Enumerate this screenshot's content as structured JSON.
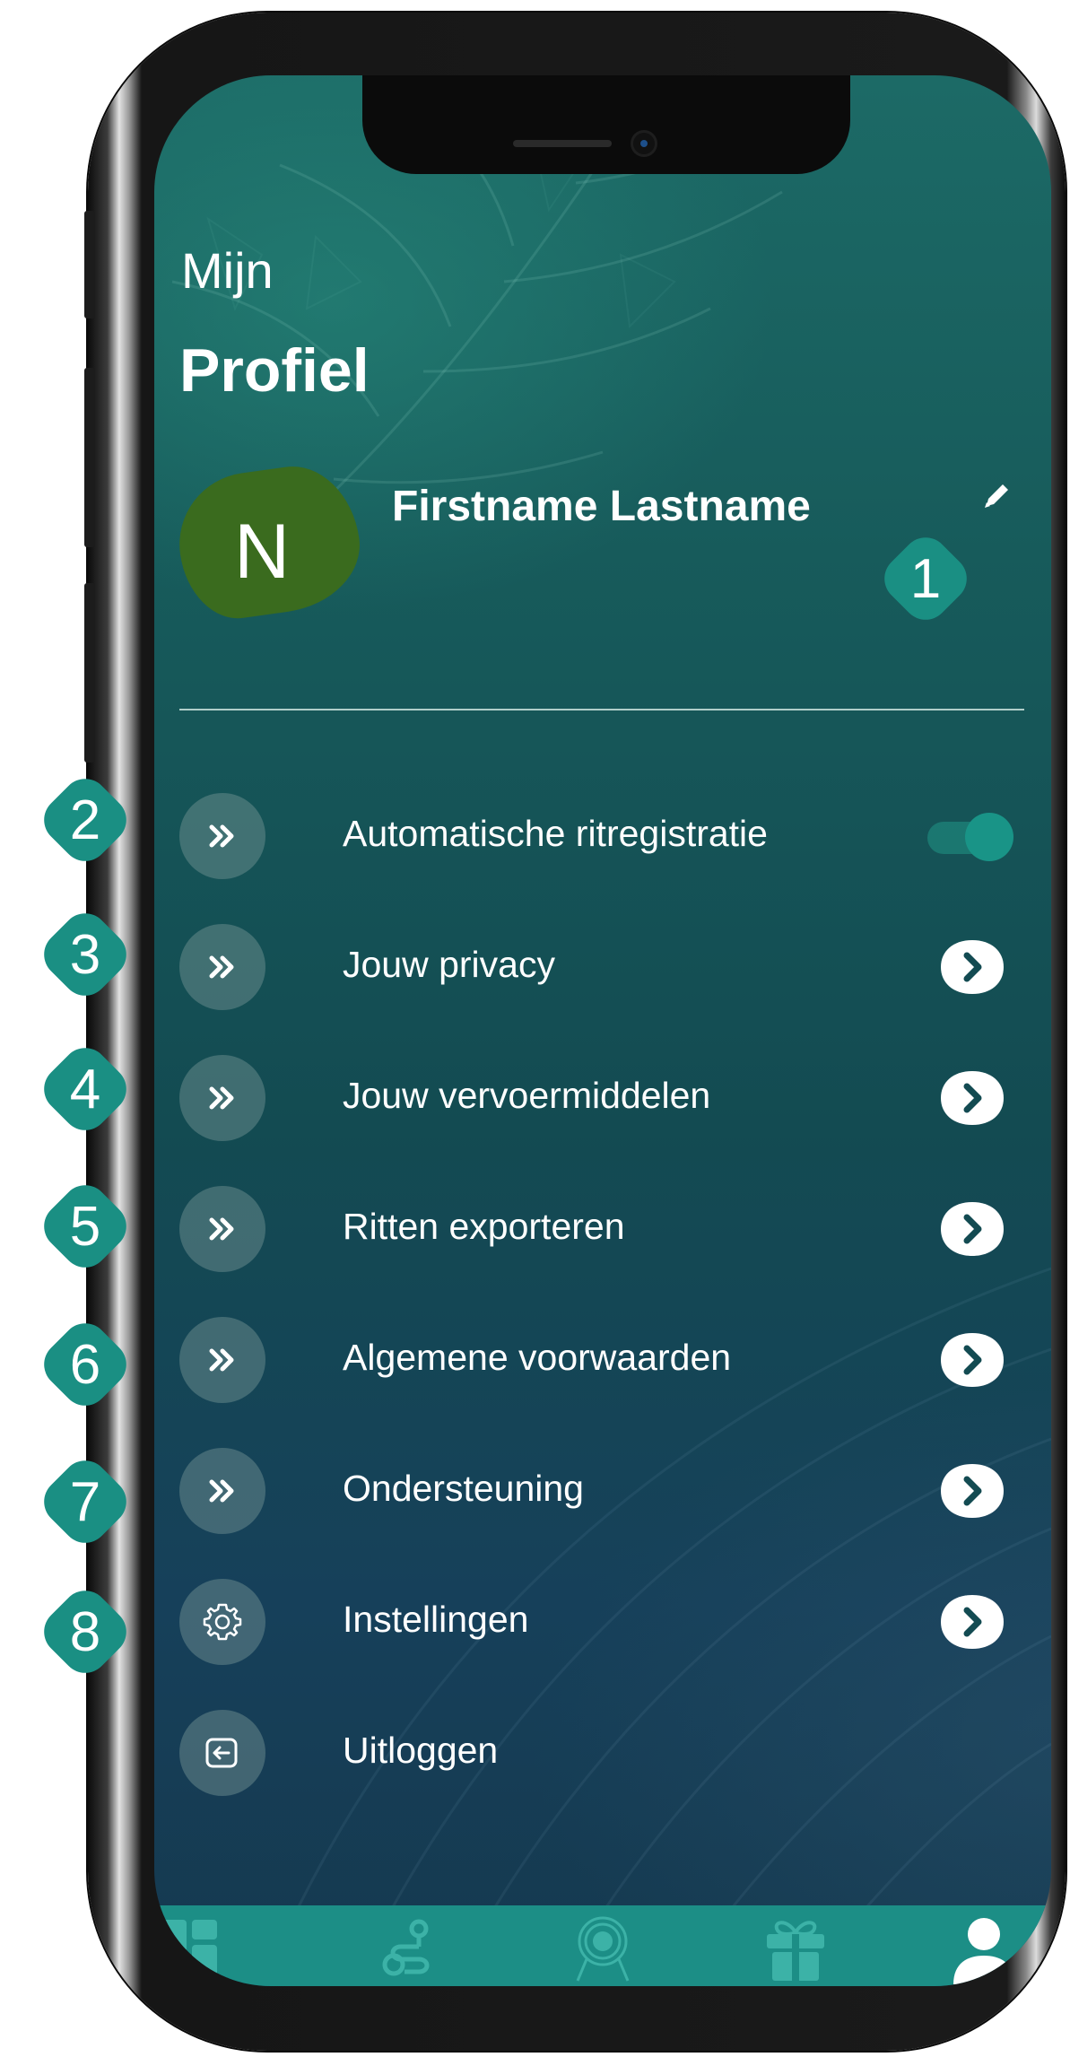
{
  "header": {
    "title_small": "Mijn",
    "title_big": "Profiel"
  },
  "profile": {
    "avatar_letter": "N",
    "name": "Firstname Lastname"
  },
  "menu": {
    "items": [
      {
        "label": "Automatische ritregistratie",
        "icon": "double-chevron-icon",
        "control": "toggle",
        "toggle_on": true
      },
      {
        "label": "Jouw privacy",
        "icon": "double-chevron-icon",
        "control": "chevron"
      },
      {
        "label": "Jouw vervoermiddelen",
        "icon": "double-chevron-icon",
        "control": "chevron"
      },
      {
        "label": "Ritten exporteren",
        "icon": "double-chevron-icon",
        "control": "chevron"
      },
      {
        "label": "Algemene voorwaarden",
        "icon": "double-chevron-icon",
        "control": "chevron"
      },
      {
        "label": "Ondersteuning",
        "icon": "double-chevron-icon",
        "control": "chevron"
      },
      {
        "label": "Instellingen",
        "icon": "gear-icon",
        "control": "chevron"
      },
      {
        "label": "Uitloggen",
        "icon": "logout-icon",
        "control": "none"
      }
    ]
  },
  "bottom_nav": {
    "items": [
      {
        "icon": "dashboard-icon"
      },
      {
        "icon": "route-icon"
      },
      {
        "icon": "badge-icon"
      },
      {
        "icon": "gift-icon"
      },
      {
        "icon": "profile-icon",
        "active": true
      }
    ]
  },
  "annotations": {
    "badges": [
      "1",
      "2",
      "3",
      "4",
      "5",
      "6",
      "7",
      "8"
    ]
  },
  "colors": {
    "badge": "#1a8f83",
    "avatar": "#3a6b1e",
    "nav_bar": "#1c8e86",
    "nav_icon_inactive": "#3cb2a7",
    "background_top": "#1c6a66",
    "background_bottom": "#15394f"
  }
}
